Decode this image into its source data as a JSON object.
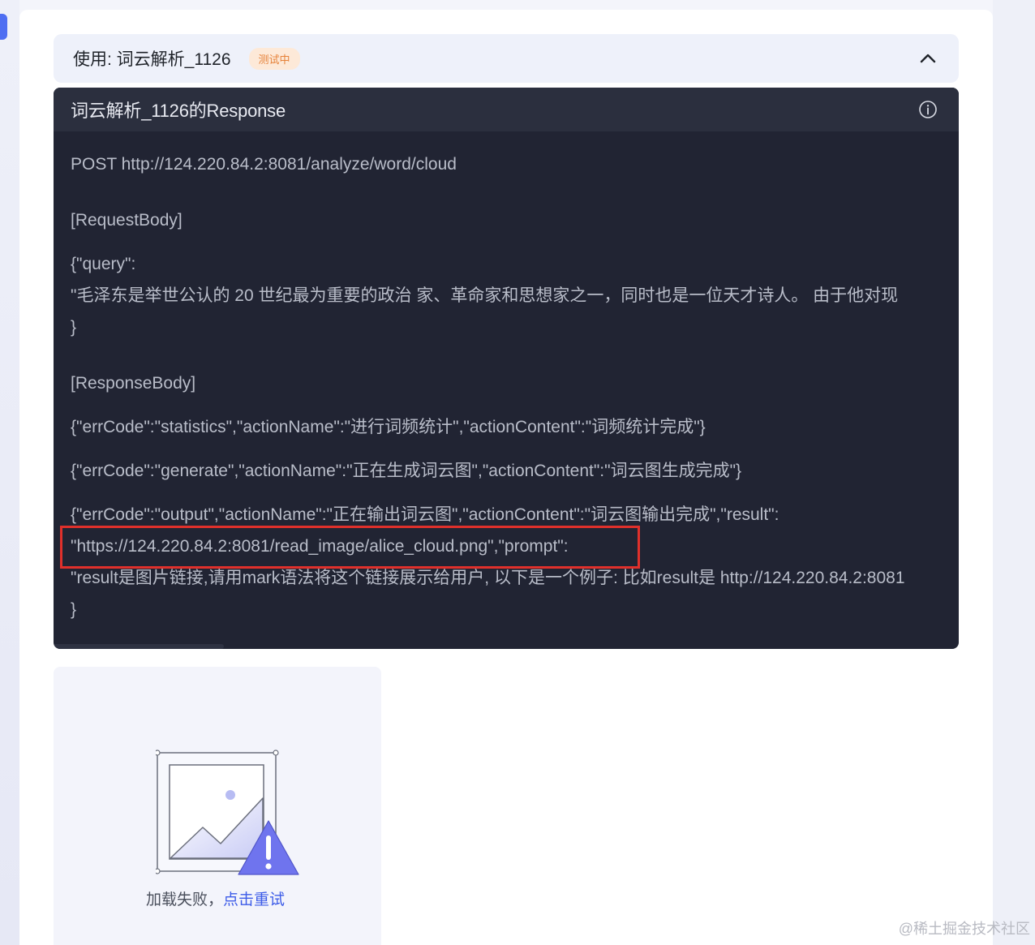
{
  "usage": {
    "title": "使用: 词云解析_1126",
    "status": "测试中",
    "collapse_icon": "chevron-up-icon"
  },
  "response": {
    "title": "词云解析_1126的Response",
    "info_icon": "info-icon",
    "lines": [
      "POST http://124.220.84.2:8081/analyze/word/cloud",
      "[RequestBody]",
      "{\"query\":",
      "\"毛泽东是举世公认的 20 世纪最为重要的政治 家、革命家和思想家之一，同时也是一位天才诗人。 由于他对现",
      "}",
      "[ResponseBody]",
      "{\"errCode\":\"statistics\",\"actionName\":\"进行词频统计\",\"actionContent\":\"词频统计完成\"}",
      "{\"errCode\":\"generate\",\"actionName\":\"正在生成词云图\",\"actionContent\":\"词云图生成完成\"}",
      "{\"errCode\":\"output\",\"actionName\":\"正在输出词云图\",\"actionContent\":\"词云图输出完成\",\"result\":",
      "\"https://124.220.84.2:8081/read_image/alice_cloud.png\",\"prompt\":",
      "\"result是图片链接,请用mark语法将这个链接展示给用户, 以下是一个例子: 比如result是 http://124.220.84.2:8081",
      "}"
    ]
  },
  "image_card": {
    "icon": "broken-image-warning-icon",
    "fail_text": "加载失败，",
    "retry_text": "点击重试"
  },
  "watermark": "@稀土掘金技术社区",
  "colors": {
    "accent": "#3d5ce8",
    "panel_bg": "#212433",
    "highlight": "#e0302b",
    "badge_text": "#e6823a"
  }
}
